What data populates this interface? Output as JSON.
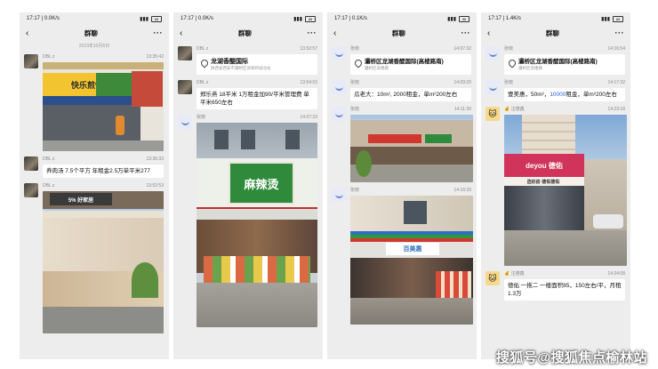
{
  "status": {
    "p1": {
      "time": "17:17",
      "speed": "0.0K/s"
    },
    "p2": {
      "time": "17:17",
      "speed": "0.0K/s"
    },
    "p3": {
      "time": "17:17",
      "speed": "0.1K/s"
    },
    "p4": {
      "time": "17:17",
      "speed": "1.4K/s"
    },
    "battery": "88"
  },
  "chat_title": "群聊",
  "p1": {
    "date": "2023年10月6日",
    "m1": {
      "sender": "DBL z",
      "time": "13:35:42"
    },
    "m2": {
      "sender": "DBL z",
      "time": "13:36:33",
      "text": "养肉汤 7.5个平方 年租金2.5万单平米277"
    },
    "m3": {
      "sender": "DBL z",
      "time": "13:52:53"
    },
    "shop1_sign": "快乐煎饼",
    "shop2_sign": "5% 好家居"
  },
  "p2": {
    "m1": {
      "sender": "DBL z",
      "time": "13:52:57",
      "loc_title": "龙湖香醍国际",
      "loc_sub": "陕西省西安市灞桥区高铁新城北站"
    },
    "m2": {
      "sender": "DBL z",
      "time": "13:54:03",
      "text": "郑乐燕 18平米 1万租金加90/平米管理费 单平米650左右"
    },
    "m3": {
      "sender": "张晓",
      "time": "14:07:23"
    },
    "shop_sign": "麻辣烫"
  },
  "p3": {
    "m1": {
      "sender": "张晓",
      "time": "14:07:32",
      "loc_title": "灞桥区龙湖香醍国际(高楼路南)",
      "loc_sub": "灞桥区高楼路"
    },
    "m2": {
      "sender": "张晓",
      "time": "14:09:20",
      "text": "瓜老大：10m², 2000租金，单m²200左右"
    },
    "m3": {
      "sender": "张晓",
      "time": "14:11:30"
    },
    "m4": {
      "sender": "张晓",
      "time": "14:16:33"
    },
    "shop_sign": "百美惠"
  },
  "p4": {
    "m1": {
      "sender": "张晓",
      "time": "14:16:54",
      "loc_title": "灞桥区龙湖香醍国际(高楼路南)",
      "loc_sub": "灞桥区高楼路"
    },
    "m2": {
      "sender": "张晓",
      "time": "14:17:32",
      "text_a": "壹美惠，50m²，",
      "text_num": "10000",
      "text_b": "租金，单m²200左右"
    },
    "m3": {
      "sender": "💰 汪德鑫",
      "time": "14:23:18"
    },
    "m4": {
      "sender": "💰 汪德鑫",
      "time": "14:24:08",
      "text": "德佑 一拖二 一楼面积85，150左右/平，月租1.3万"
    },
    "brand": "deyou 德佑",
    "brand_sub": "选好房·德佑德佑"
  },
  "watermark": "搜狐号@搜狐焦点榆林站"
}
